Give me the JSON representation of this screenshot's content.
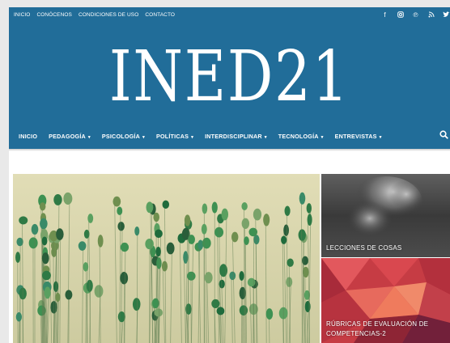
{
  "topbar": {
    "links": [
      "INICIO",
      "CONÓCENOS",
      "CONDICIONES DE USO",
      "CONTACTO"
    ],
    "social_icons": [
      "facebook-icon",
      "instagram-icon",
      "pinterest-icon",
      "rss-icon",
      "twitter-icon"
    ]
  },
  "site": {
    "logo": "INED21"
  },
  "nav": {
    "items": [
      {
        "label": "INICIO",
        "dropdown": false
      },
      {
        "label": "PEDAGOGÍA",
        "dropdown": true
      },
      {
        "label": "PSICOLOGÍA",
        "dropdown": true
      },
      {
        "label": "POLÍTICAS",
        "dropdown": true
      },
      {
        "label": "INTERDISCIPLINAR",
        "dropdown": true
      },
      {
        "label": "TECNOLOGÍA",
        "dropdown": true
      },
      {
        "label": "ENTREVISTAS",
        "dropdown": true
      }
    ],
    "caret": "▾",
    "search_icon": "search-icon"
  },
  "featured": {
    "side_posts": [
      {
        "title": "LECCIONES DE COSAS"
      },
      {
        "title_line1": "RÚBRICAS DE EVALUACIÓN DE",
        "title_line2": "COMPETENCIAS-2"
      }
    ]
  },
  "colors": {
    "header": "#216d99",
    "text_on_header": "#ffffff"
  }
}
